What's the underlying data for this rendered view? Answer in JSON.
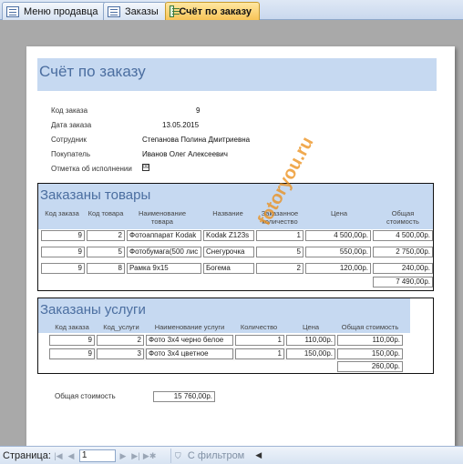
{
  "tabs": [
    {
      "label": "Меню продавца",
      "icon": "form-icon"
    },
    {
      "label": "Заказы",
      "icon": "form-icon"
    },
    {
      "label": "Счёт по заказу",
      "icon": "report-icon"
    }
  ],
  "report": {
    "title": "Счёт по заказу",
    "fields": {
      "order_code_label": "Код заказа",
      "order_code": "9",
      "order_date_label": "Дата заказа",
      "order_date": "13.05.2015",
      "employee_label": "Сотрудник",
      "employee": "Степанова Полина Дмитриевна",
      "buyer_label": "Покупатель",
      "buyer": "Иванов Олег Алексеевич",
      "completed_label": "Отметка об исполнении",
      "completed_mark": "☒"
    },
    "goods": {
      "title": "Заказаны товары",
      "headers": {
        "c1": "Код заказа",
        "c2": "Код товара",
        "c3": "Наименование товара",
        "c4": "Название",
        "c5": "Заказанное количество",
        "c6": "Цена",
        "c7": "Общая стоимость"
      },
      "rows": [
        {
          "order": "9",
          "item": "2",
          "name": "Фотоаппарат Kodak",
          "title": "Kodak Z123s",
          "qty": "1",
          "price": "4 500,00р.",
          "total": "4 500,00р."
        },
        {
          "order": "9",
          "item": "5",
          "name": "Фотобумага(500 лис",
          "title": "Снегурочка",
          "qty": "5",
          "price": "550,00р.",
          "total": "2 750,00р."
        },
        {
          "order": "9",
          "item": "8",
          "name": "Рамка 9х15",
          "title": "Богема",
          "qty": "2",
          "price": "120,00р.",
          "total": "240,00р."
        }
      ],
      "sum": "7 490,00р."
    },
    "services": {
      "title": "Заказаны услуги",
      "headers": {
        "c1": "Код заказа",
        "c2": "Код_услуги",
        "c3": "Наименование услуги",
        "c4": "Количество",
        "c5": "Цена",
        "c6": "Общая стоимость"
      },
      "rows": [
        {
          "order": "9",
          "code": "2",
          "name": "Фото 3х4 черно белое",
          "qty": "1",
          "price": "110,00р.",
          "total": "110,00р."
        },
        {
          "order": "9",
          "code": "3",
          "name": "Фото 3х4 цветное",
          "qty": "1",
          "price": "150,00р.",
          "total": "150,00р."
        }
      ],
      "sum": "260,00р."
    },
    "grand_total_label": "Общая стоимость",
    "grand_total": "15 760,00р."
  },
  "watermark": "fotoryou.ru",
  "nav": {
    "page_label": "Страница:",
    "page_value": "1",
    "filter_label": "С фильтром"
  }
}
